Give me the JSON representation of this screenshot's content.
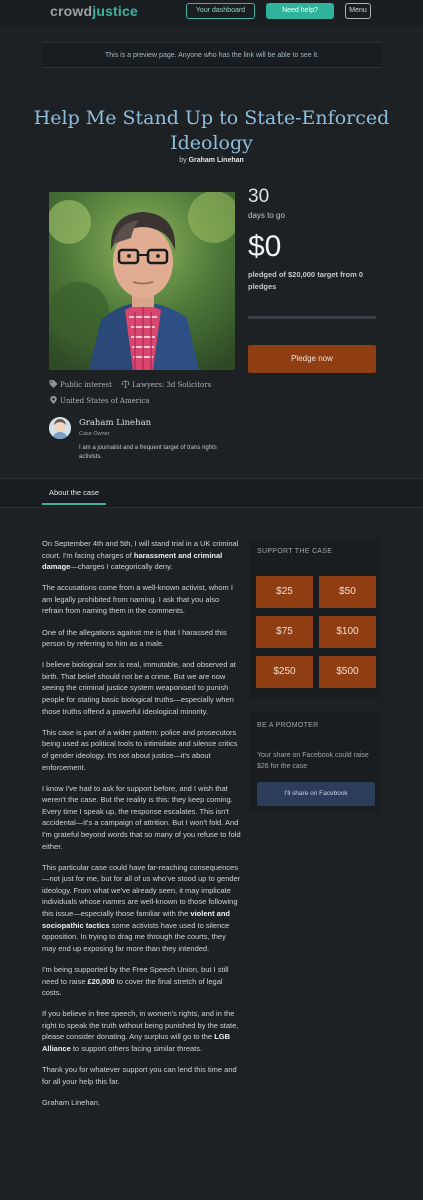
{
  "header": {
    "logo_part1": "crowd",
    "logo_part2": "justice",
    "dashboard_label": "Your dashboard",
    "help_label": "Need help?",
    "menu_label": "Menu"
  },
  "preview_notice": "This is a preview page. Anyone who has the link will be able to see it.",
  "campaign": {
    "title": "Help Me Stand Up to State-Enforced Ideology",
    "by_prefix": "by",
    "author": "Graham Linehan",
    "days_left": "30",
    "days_label": "days to go",
    "amount_raised": "$0",
    "pledged_text": "pledged of $20,000 target from 0 pledges",
    "progress_fraction": 0,
    "pledge_button": "Pledge now",
    "tags": {
      "category": "Public interest",
      "lawyers": "Lawyers: 3d Solicitors",
      "location": "United States of America"
    },
    "owner": {
      "name": "Graham Linehan",
      "role": "Case Owner",
      "bio": "I am a journalist and a frequent target of trans rights activists."
    }
  },
  "tabs": [
    {
      "label": "About the case",
      "active": true
    }
  ],
  "story": {
    "p1_a": "On September 4th and 5th, I will stand trial in a UK criminal court. I'm facing charges of ",
    "p1_b": "harassment and criminal damage",
    "p1_c": "—charges I categorically deny.",
    "p2": "The accusations come from a well-known activist, whom I am legally prohibited from naming. I ask that you also refrain from naming them in the comments.",
    "p3": "One of the allegations against me is that I harassed this person by referring to him as a male.",
    "p4": "I believe biological sex is real, immutable, and observed at birth. That belief should not be a crime. But we are now seeing the criminal justice system weaponised to punish people for stating basic biological truths—especially when those truths offend a powerful ideological minority.",
    "p5": "This case is part of a wider pattern: police and prosecutors being used as political tools to intimidate and silence critics of gender ideology. It's not about justice—it's about enforcement.",
    "p6": "I know I've had to ask for support before, and I wish that weren't the case. But the reality is this: they keep coming. Every time I speak up, the response escalates. This isn't accidental—it's a campaign of attrition. But I won't fold. And I'm grateful beyond words that so many of you refuse to fold either.",
    "p7_a": "This particular case could have far-reaching consequences—not just for me, but for all of us who've stood up to gender ideology. From what we've already seen, it may implicate individuals whose names are well-known to those following this issue—especially those familiar with the ",
    "p7_b": "violent and sociopathic tactics",
    "p7_c": " some activists have used to silence opposition. In trying to drag me through the courts, they may end up exposing far more than they intended.",
    "p8_a": "I'm being supported by the Free Speech Union, but I still need to raise ",
    "p8_b": "£20,000",
    "p8_c": " to cover the final stretch of legal costs.",
    "p9_a": "If you believe in free speech, in women's rights, and in the right to speak the truth without being punished by the state, please consider donating. Any surplus will go to the ",
    "p9_b": "LGB Alliance",
    "p9_c": " to support others facing similar threats.",
    "p10": "Thank you for whatever support you can lend this time and for all your help this far.",
    "p11": "Graham Linehan."
  },
  "sidebar": {
    "support_title": "SUPPORT THE CASE",
    "amounts": [
      "$25",
      "$50",
      "$75",
      "$100",
      "$250",
      "$500"
    ],
    "promoter_title": "BE A PROMOTER",
    "promoter_text": "Your share on Facebook could raise $26 for the case",
    "share_button": "I'll share on Facebook"
  },
  "colors": {
    "accent": "#3bb3a0",
    "pledge": "#8f3d12",
    "title": "#8ebedc",
    "facebook": "#2c3d5c"
  }
}
